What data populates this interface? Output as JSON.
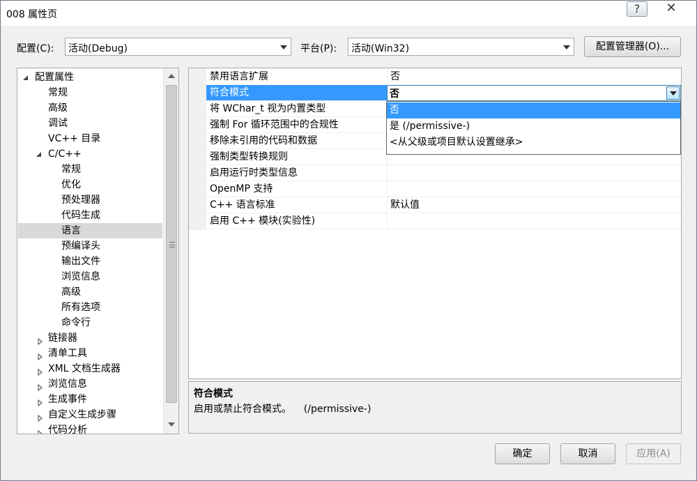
{
  "window": {
    "title": "008 属性页",
    "help_label": "?",
    "close_label": "✕"
  },
  "config": {
    "config_label": "配置(C):",
    "config_value": "活动(Debug)",
    "platform_label": "平台(P):",
    "platform_value": "活动(Win32)",
    "manager_label": "配置管理器(O)..."
  },
  "tree": {
    "items": [
      {
        "label": "配置属性",
        "expander": "open"
      },
      {
        "label": "常规",
        "expander": ""
      },
      {
        "label": "高级",
        "expander": ""
      },
      {
        "label": "调试",
        "expander": ""
      },
      {
        "label": "VC++ 目录",
        "expander": ""
      },
      {
        "label": "C/C++",
        "expander": "open"
      },
      {
        "label": "常规",
        "expander": ""
      },
      {
        "label": "优化",
        "expander": ""
      },
      {
        "label": "预处理器",
        "expander": ""
      },
      {
        "label": "代码生成",
        "expander": ""
      },
      {
        "label": "语言",
        "expander": "",
        "selected": true
      },
      {
        "label": "预编译头",
        "expander": ""
      },
      {
        "label": "输出文件",
        "expander": ""
      },
      {
        "label": "浏览信息",
        "expander": ""
      },
      {
        "label": "高级",
        "expander": ""
      },
      {
        "label": "所有选项",
        "expander": ""
      },
      {
        "label": "命令行",
        "expander": ""
      },
      {
        "label": "链接器",
        "expander": "closed"
      },
      {
        "label": "清单工具",
        "expander": "closed"
      },
      {
        "label": "XML 文档生成器",
        "expander": "closed"
      },
      {
        "label": "浏览信息",
        "expander": "closed"
      },
      {
        "label": "生成事件",
        "expander": "closed"
      },
      {
        "label": "自定义生成步骤",
        "expander": "closed"
      },
      {
        "label": "代码分析",
        "expander": "closed"
      }
    ]
  },
  "grid": {
    "rows": [
      {
        "name": "禁用语言扩展",
        "value": "否"
      },
      {
        "name": "符合模式",
        "value": "否",
        "selected": true
      },
      {
        "name": "将 WChar_t 视为内置类型",
        "value": ""
      },
      {
        "name": "强制 For 循环范围中的合规性",
        "value": ""
      },
      {
        "name": "移除未引用的代码和数据",
        "value": ""
      },
      {
        "name": "强制类型转换规则",
        "value": ""
      },
      {
        "name": "启用运行时类型信息",
        "value": ""
      },
      {
        "name": "OpenMP 支持",
        "value": ""
      },
      {
        "name": "C++ 语言标准",
        "value": "默认值"
      },
      {
        "name": "启用 C++ 模块(实验性)",
        "value": ""
      }
    ],
    "dropdown_options": [
      {
        "label": "否",
        "selected": true
      },
      {
        "label": "是 (/permissive-)"
      },
      {
        "label": "<从父级或项目默认设置继承>"
      }
    ]
  },
  "description": {
    "title": "符合模式",
    "text": "启用或禁止符合模式。    (/permissive-)"
  },
  "buttons": {
    "ok": "确定",
    "cancel": "取消",
    "apply": "应用(A)"
  },
  "colors": {
    "selection": "#3399ff",
    "tree_selection": "#d9d9d9"
  }
}
